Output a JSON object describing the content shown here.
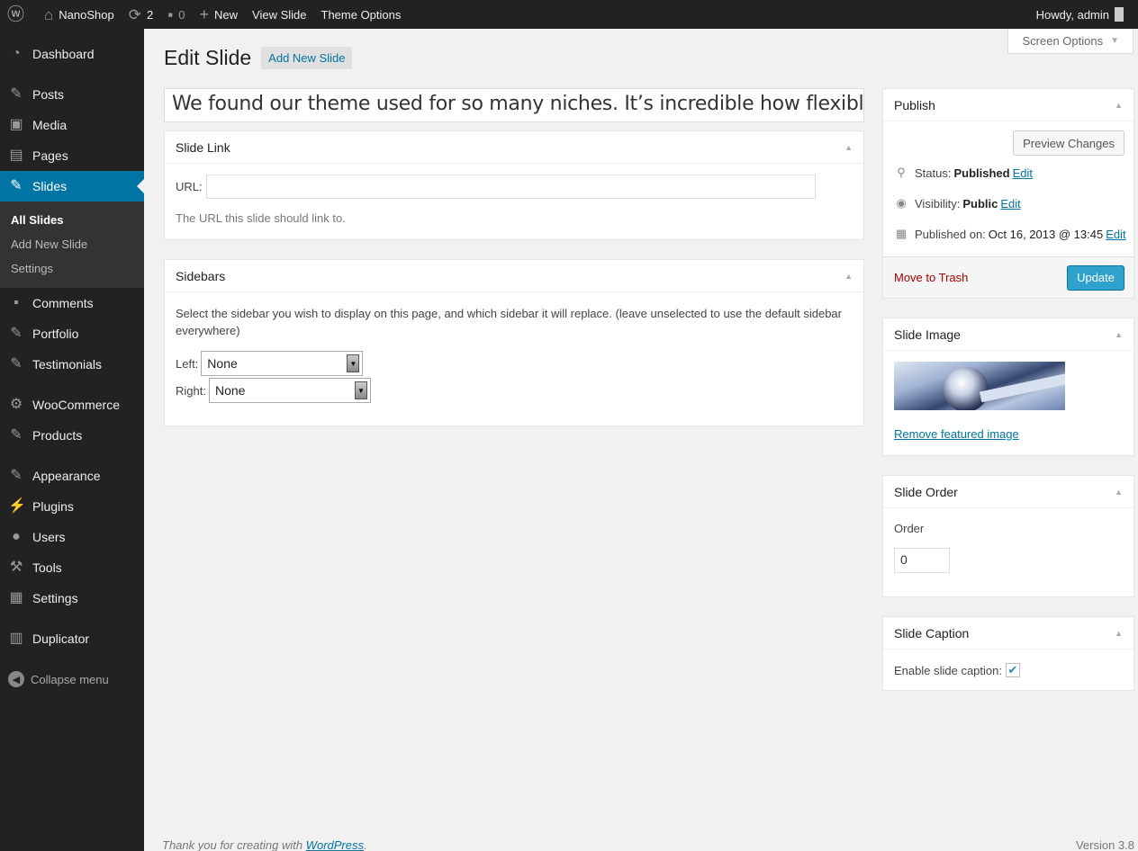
{
  "adminbar": {
    "site_name": "NanoShop",
    "updates_count": "2",
    "comments_count": "0",
    "new_label": "New",
    "view_label": "View Slide",
    "theme_options_label": "Theme Options",
    "greeting": "Howdy, admin"
  },
  "menu": {
    "dashboard": "Dashboard",
    "posts": "Posts",
    "media": "Media",
    "pages": "Pages",
    "slides": "Slides",
    "sub_all_slides": "All Slides",
    "sub_add_new_slide": "Add New Slide",
    "sub_settings": "Settings",
    "comments": "Comments",
    "portfolio": "Portfolio",
    "testimonials": "Testimonials",
    "woocommerce": "WooCommerce",
    "products": "Products",
    "appearance": "Appearance",
    "plugins": "Plugins",
    "users": "Users",
    "tools": "Tools",
    "settings": "Settings",
    "duplicator": "Duplicator",
    "collapse": "Collapse menu"
  },
  "page": {
    "screen_options": "Screen Options",
    "title": "Edit Slide",
    "add_new": "Add New Slide",
    "post_title": "We found our theme used for so many niches. It’s incredible how flexible th"
  },
  "slide_link": {
    "heading": "Slide Link",
    "url_label": "URL:",
    "url_value": "",
    "description": "The URL this slide should link to."
  },
  "sidebars": {
    "heading": "Sidebars",
    "description": "Select the sidebar you wish to display on this page, and which sidebar it will replace. (leave unselected to use the default sidebar everywhere)",
    "left_label": "Left:",
    "left_value": "None",
    "right_label": "Right:",
    "right_value": "None"
  },
  "publish": {
    "heading": "Publish",
    "preview_button": "Preview Changes",
    "status_label": "Status:",
    "status_value": "Published",
    "visibility_label": "Visibility:",
    "visibility_value": "Public",
    "published_label": "Published on:",
    "published_value": "Oct 16, 2013 @ 13:45",
    "edit_link": "Edit",
    "trash_link": "Move to Trash",
    "update_button": "Update"
  },
  "slide_image": {
    "heading": "Slide Image",
    "remove_link": "Remove featured image"
  },
  "slide_order": {
    "heading": "Slide Order",
    "order_label": "Order",
    "order_value": "0"
  },
  "slide_caption": {
    "heading": "Slide Caption",
    "enable_label": "Enable slide caption:",
    "enabled": true
  },
  "footer": {
    "thanks_text": "Thank you for creating with ",
    "wp_link": "WordPress",
    "period": ".",
    "version": "Version 3.8"
  },
  "colors": {
    "admin_bar_bg": "#222222",
    "menu_current_bg": "#0074a2",
    "primary_button": "#2ea2cc",
    "link": "#0074a2",
    "trash": "#aa0000"
  }
}
